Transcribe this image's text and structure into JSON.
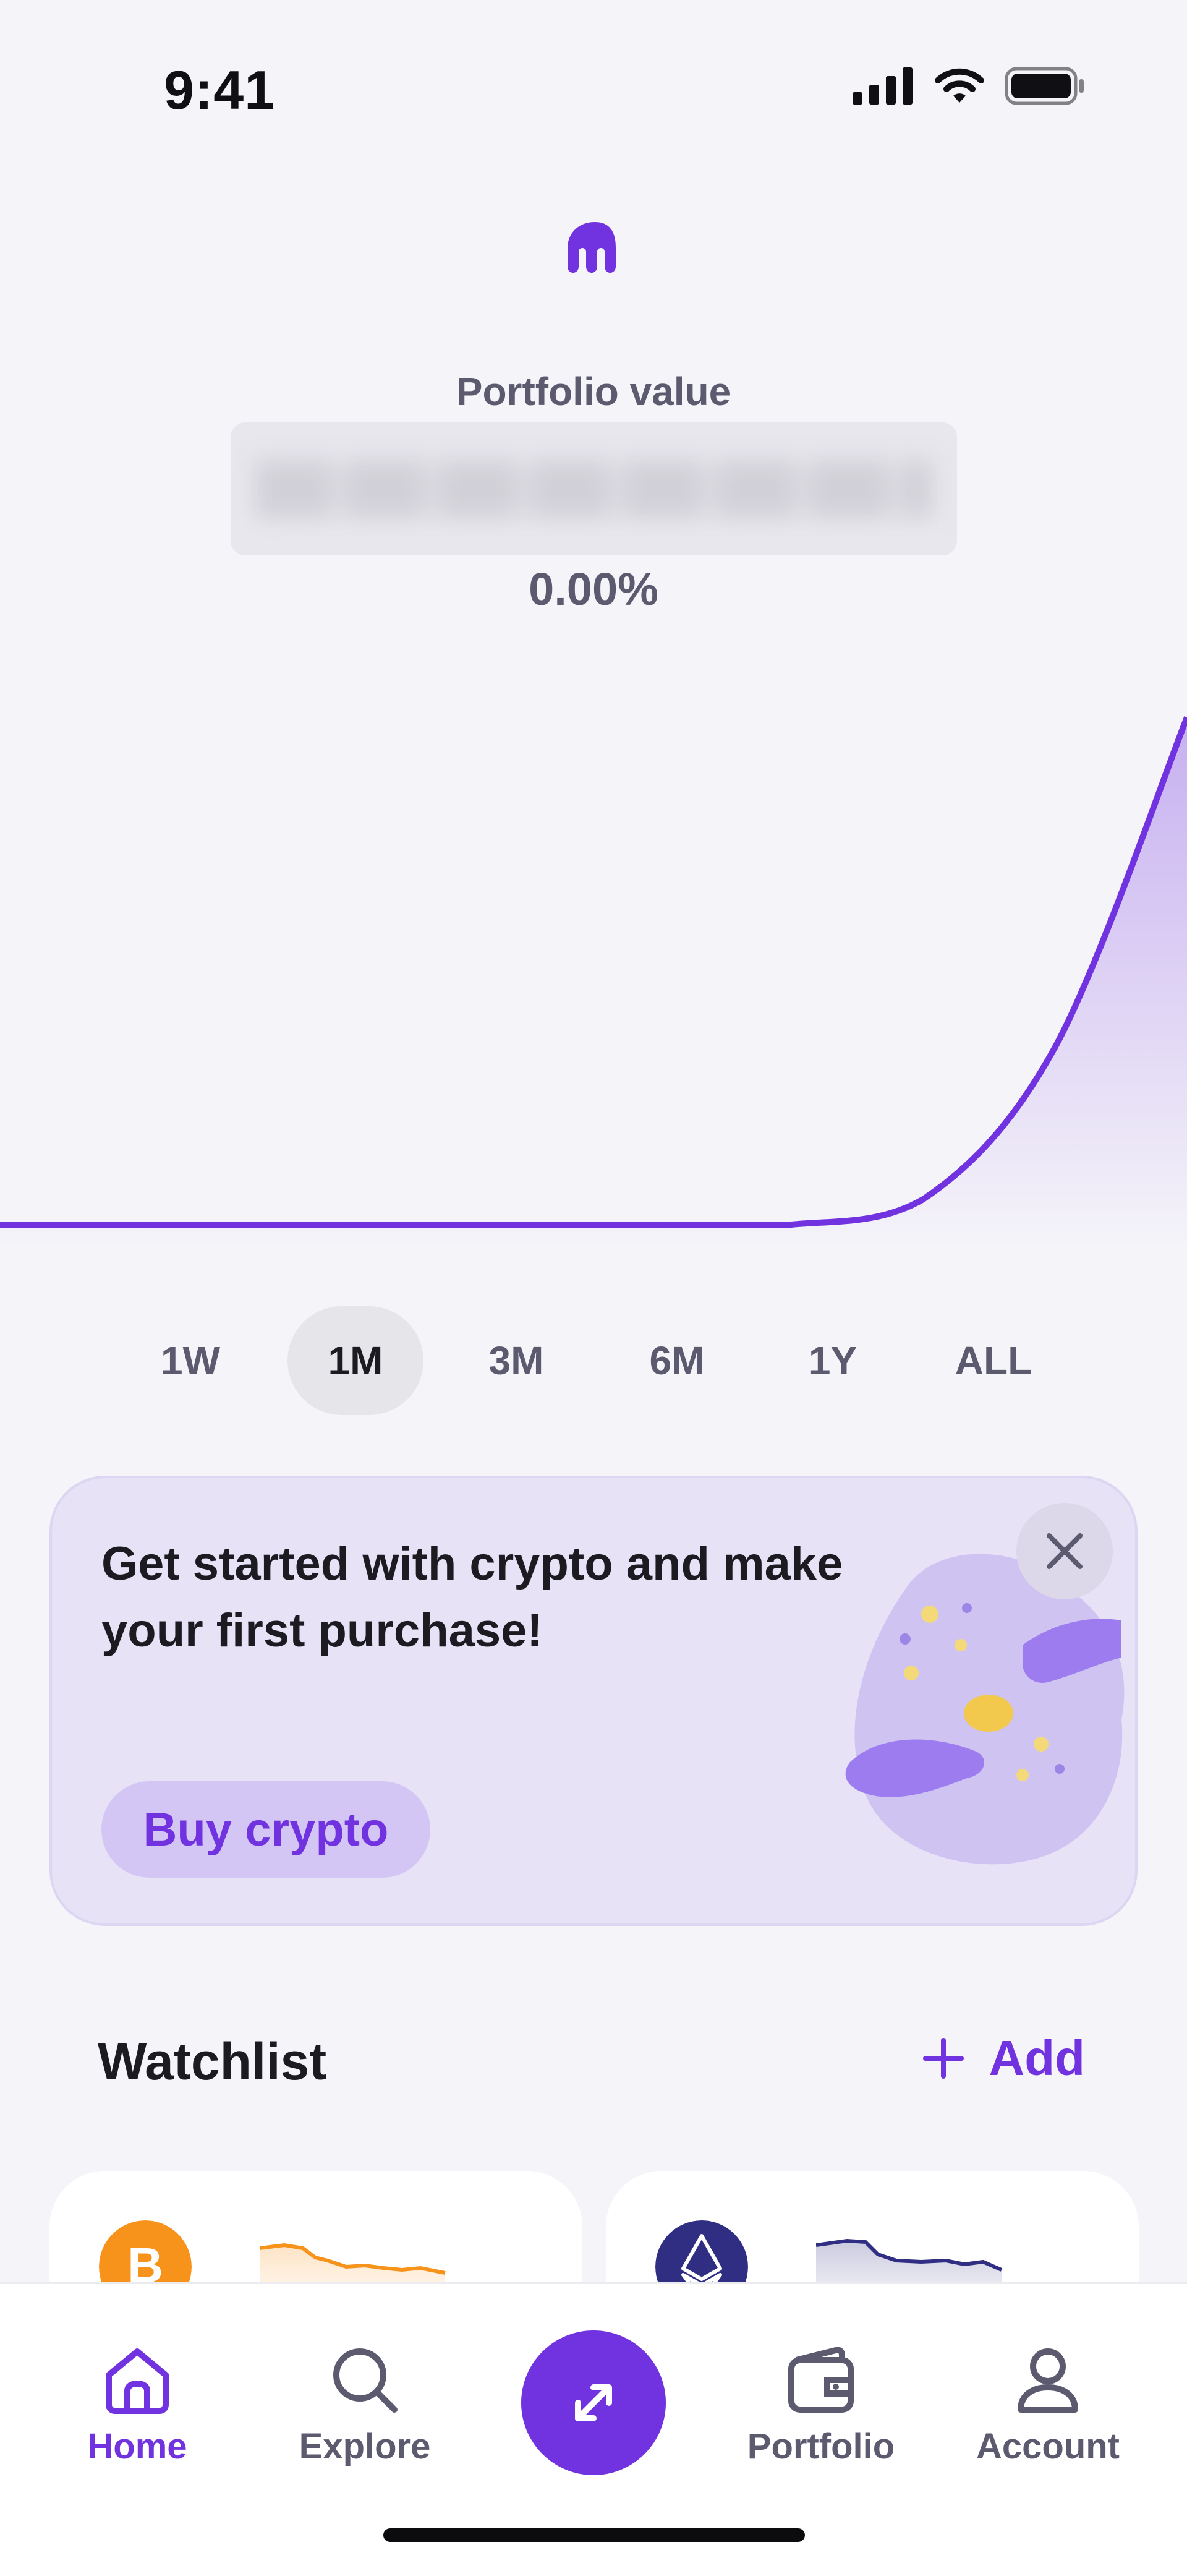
{
  "status_bar": {
    "time": "9:41"
  },
  "portfolio": {
    "label": "Portfolio value",
    "change": "0.00%"
  },
  "chart_data": {
    "type": "area",
    "series": [
      {
        "values": [
          0,
          0,
          0,
          0,
          0,
          0,
          0,
          0.05,
          0.35,
          1.0
        ]
      }
    ]
  },
  "ranges": [
    {
      "label": "1W"
    },
    {
      "label": "1M",
      "active": true
    },
    {
      "label": "3M"
    },
    {
      "label": "6M"
    },
    {
      "label": "1Y"
    },
    {
      "label": "ALL"
    }
  ],
  "promo": {
    "text": "Get started with crypto and make your first purchase!",
    "button_label": "Buy crypto"
  },
  "watchlist": {
    "title": "Watchlist",
    "add_label": "Add",
    "coins": [
      {
        "icon": "bitcoin-icon",
        "color": "#f7931a",
        "line_color": "#f7931a"
      },
      {
        "icon": "ethereum-icon",
        "color": "#2f2e82",
        "line_color": "#2f2e82"
      }
    ]
  },
  "nav": {
    "items": [
      {
        "label": "Home",
        "icon": "home-icon",
        "active": true
      },
      {
        "label": "Explore",
        "icon": "search-icon"
      },
      {
        "label": "Portfolio",
        "icon": "wallet-icon"
      },
      {
        "label": "Account",
        "icon": "user-icon"
      }
    ],
    "trade_icon": "swap-arrows-icon"
  },
  "colors": {
    "accent": "#7132e0",
    "background": "#f5f4f9"
  }
}
